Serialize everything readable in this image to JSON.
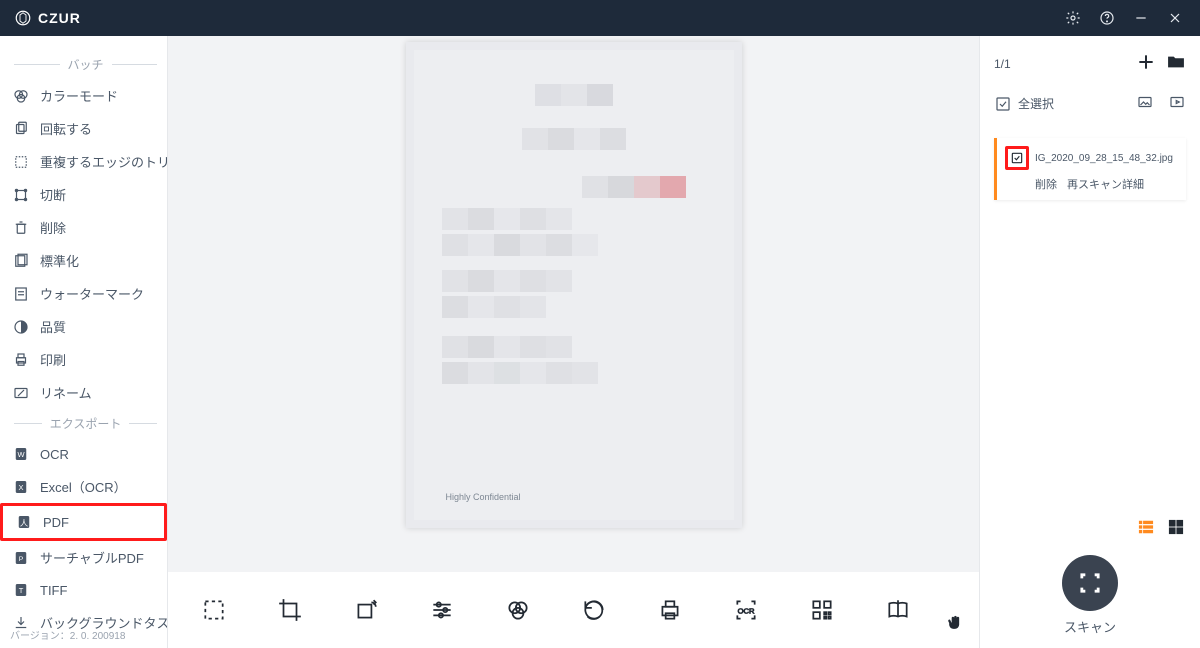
{
  "titlebar": {
    "brand": "CZUR"
  },
  "sidebar": {
    "section_batch": "バッチ",
    "section_export": "エクスポート",
    "batch_items": [
      "カラーモード",
      "回転する",
      "重複するエッジのトリミング",
      "切断",
      "削除",
      "標準化",
      "ウォーターマーク",
      "品質",
      "印刷",
      "リネーム"
    ],
    "export_items": [
      "OCR",
      "Excel（OCR）",
      "PDF",
      "サーチャブルPDF",
      "TIFF",
      "バックグラウンドタスク"
    ],
    "version": "バージョン：2. 0. 200918"
  },
  "preview": {
    "confidential": "Highly Confidential"
  },
  "rightpanel": {
    "page_counter": "1/1",
    "select_all": "全選択",
    "thumb": {
      "filename": "IG_2020_09_28_15_48_32.jpg",
      "delete": "削除",
      "rescan": "再スキャン詳細"
    },
    "scan_label": "スキャン"
  }
}
